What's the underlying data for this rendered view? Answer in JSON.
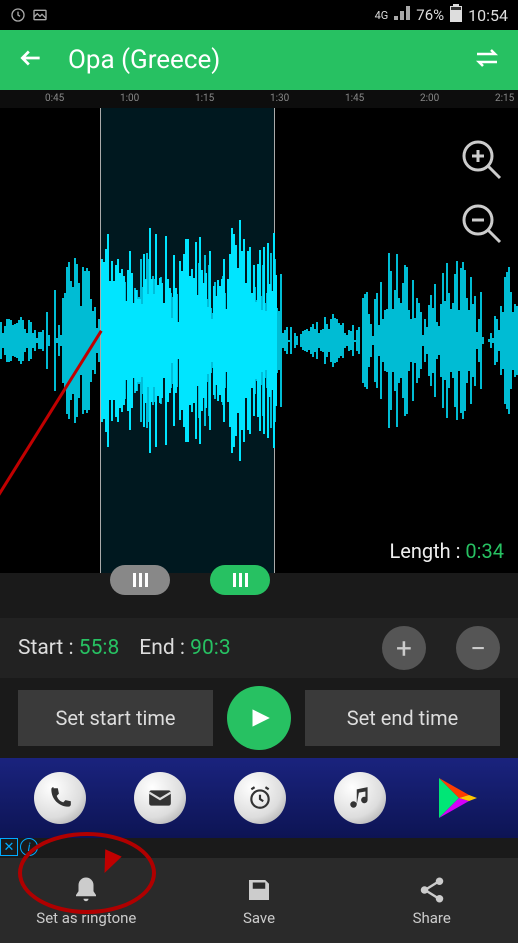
{
  "status": {
    "network": "4G",
    "battery": "76%",
    "time": "10:54"
  },
  "header": {
    "title": "Opa (Greece)"
  },
  "timeline": {
    "ticks": [
      "0:45",
      "1:00",
      "1:15",
      "1:30",
      "1:45",
      "2:00",
      "2:15"
    ]
  },
  "length": {
    "label": "Length :",
    "value": "0:34"
  },
  "times": {
    "start_label": "Start :",
    "start_value": "55:8",
    "end_label": "End :",
    "end_value": "90:3"
  },
  "buttons": {
    "set_start": "Set start time",
    "set_end": "Set end time",
    "plus": "+",
    "minus": "−"
  },
  "nav": {
    "ringtone": "Set as ringtone",
    "save": "Save",
    "share": "Share"
  }
}
